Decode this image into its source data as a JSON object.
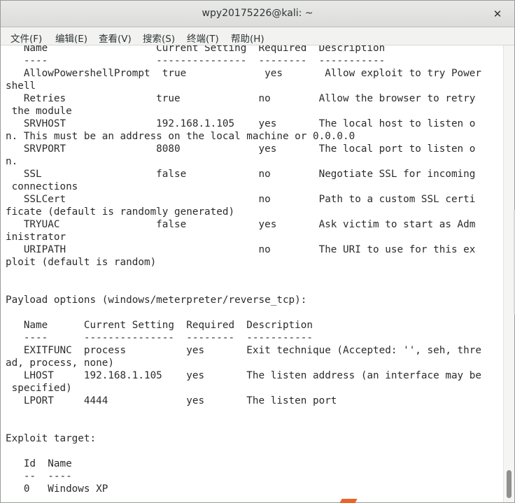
{
  "window": {
    "title": "wpy20175226@kali: ~",
    "close_glyph": "✕"
  },
  "menubar": {
    "items": [
      "文件(F)",
      "编辑(E)",
      "查看(V)",
      "搜索(S)",
      "终端(T)",
      "帮助(H)"
    ]
  },
  "terminal": {
    "lines": [
      "   Name                  Current Setting  Required  Description",
      "   ----                  ---------------  --------  -----------",
      "   AllowPowershellPrompt  true             yes       Allow exploit to try Power",
      "shell",
      "   Retries               true             no        Allow the browser to retry",
      " the module",
      "   SRVHOST               192.168.1.105    yes       The local host to listen o",
      "n. This must be an address on the local machine or 0.0.0.0",
      "   SRVPORT               8080             yes       The local port to listen o",
      "n.",
      "   SSL                   false            no        Negotiate SSL for incoming",
      " connections",
      "   SSLCert                                no        Path to a custom SSL certi",
      "ficate (default is randomly generated)",
      "   TRYUAC                false            yes       Ask victim to start as Adm",
      "inistrator",
      "   URIPATH                                no        The URI to use for this ex",
      "ploit (default is random)",
      "",
      "",
      "Payload options (windows/meterpreter/reverse_tcp):",
      "",
      "   Name      Current Setting  Required  Description",
      "   ----      ---------------  --------  -----------",
      "   EXITFUNC  process          yes       Exit technique (Accepted: '', seh, thre",
      "ad, process, none)",
      "   LHOST     192.168.1.105    yes       The listen address (an interface may be",
      " specified)",
      "   LPORT     4444             yes       The listen port",
      "",
      "",
      "Exploit target:",
      "",
      "   Id  Name",
      "   --  ----",
      "   0   Windows XP"
    ]
  },
  "colors": {
    "terminal_background": "#ffffff",
    "terminal_foreground": "#2b2b2b",
    "titlebar": "#e3e3e1",
    "menubar": "#f2f2f1"
  }
}
